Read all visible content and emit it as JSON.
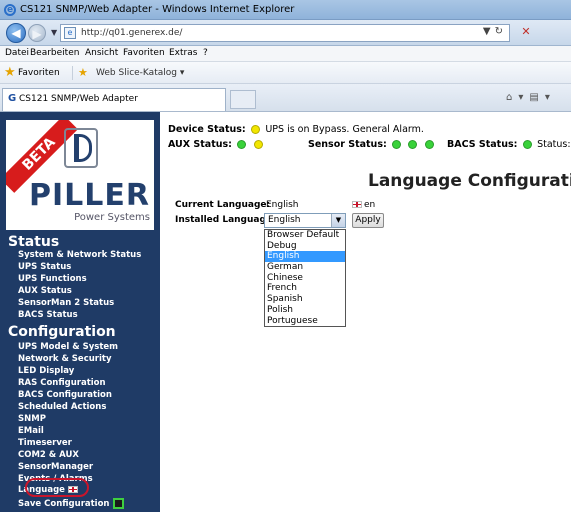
{
  "browser": {
    "window_title": "CS121 SNMP/Web Adapter - Windows Internet Explorer",
    "url": "http://q01.generex.de/",
    "menu": [
      "Datei",
      "Bearbeiten",
      "Ansicht",
      "Favoriten",
      "Extras",
      "?"
    ],
    "favorites_label": "Favoriten",
    "web_slice_label": "Web Slice-Katalog",
    "tab_title": "CS121 SNMP/Web Adapter"
  },
  "sidebar": {
    "beta_badge": "BETA",
    "brand": "PILLER",
    "tagline": "Power Systems",
    "status_heading": "Status",
    "status_items": [
      "System & Network Status",
      "UPS Status",
      "UPS Functions",
      "AUX Status",
      "SensorMan 2 Status",
      "BACS Status"
    ],
    "config_heading": "Configuration",
    "config_items": [
      "UPS Model & System",
      "Network & Security",
      "LED Display",
      "RAS Configuration",
      "BACS Configuration",
      "Scheduled Actions",
      "SNMP",
      "EMail",
      "Timeserver",
      "COM2 & AUX",
      "SensorManager",
      "Events / Alarms"
    ],
    "language_item": "Language",
    "save_item": "Save Configuration"
  },
  "status": {
    "device_label": "Device Status:",
    "device_text": "UPS is on Bypass. General Alarm.",
    "aux_label": "AUX Status:",
    "sensor_label": "Sensor Status:",
    "bacs_label": "BACS Status:",
    "bacs_text": "Status: Floa",
    "colors": {
      "yellow": "#f2e600",
      "green": "#39d23a"
    }
  },
  "main": {
    "title": "Language Configuration",
    "current_language_label": "Current Language:",
    "current_language_value": "English",
    "current_language_code": "en",
    "installed_languages_label": "Installed Languages:",
    "selected_language": "English",
    "apply_label": "Apply",
    "options": [
      "Browser Default",
      "Debug",
      "English",
      "German",
      "Chinese",
      "French",
      "Spanish",
      "Polish",
      "Portuguese"
    ]
  }
}
